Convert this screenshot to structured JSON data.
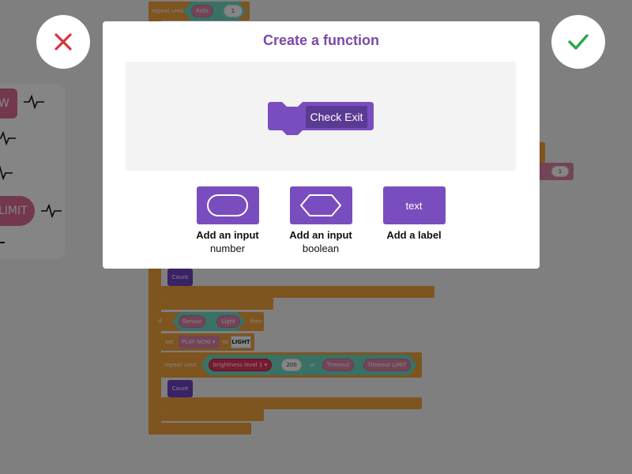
{
  "dialog": {
    "title": "Create a function",
    "function_block_label": "Check Exit",
    "options": [
      {
        "title": "Add an input",
        "subtitle": "number",
        "icon": "rounded-rect-input-icon"
      },
      {
        "title": "Add an input",
        "subtitle": "boolean",
        "icon": "hexagon-input-icon"
      },
      {
        "title": "Add a label",
        "subtitle": "",
        "chip_text": "text"
      }
    ]
  },
  "actions": {
    "cancel_icon": "close-icon",
    "confirm_icon": "check-icon",
    "cancel_color": "#d6343f",
    "confirm_color": "#2aa84a"
  },
  "workspace": {
    "top_repeat_label": "repeat until",
    "top_falls_label": "Falls",
    "top_value": "1",
    "right_value": "1",
    "side_pills": [
      "W",
      "LIMIT"
    ],
    "count_label_1": "Count",
    "if_label": "if",
    "sensor_label": "Sensor",
    "light_label": "Light",
    "then_label": "then",
    "set_label": "set",
    "set_var": "PLAY NOW ▾",
    "to_label": "to",
    "light_value": "LIGHT",
    "repeat_label": "repeat until",
    "brightness_label": "brightness level 1 ▾",
    "brightness_value": "200",
    "or_label": "or",
    "timeout_label": "Timeout",
    "timeout_limit_label": "Timeout LIMIT",
    "count_label_2": "Count"
  },
  "colors": {
    "accent_purple": "#7a4dbf",
    "title_purple": "#7a4aa8",
    "block_orange": "#f2a13c",
    "block_teal": "#6ed8c4",
    "block_pink": "#dd83a8"
  }
}
